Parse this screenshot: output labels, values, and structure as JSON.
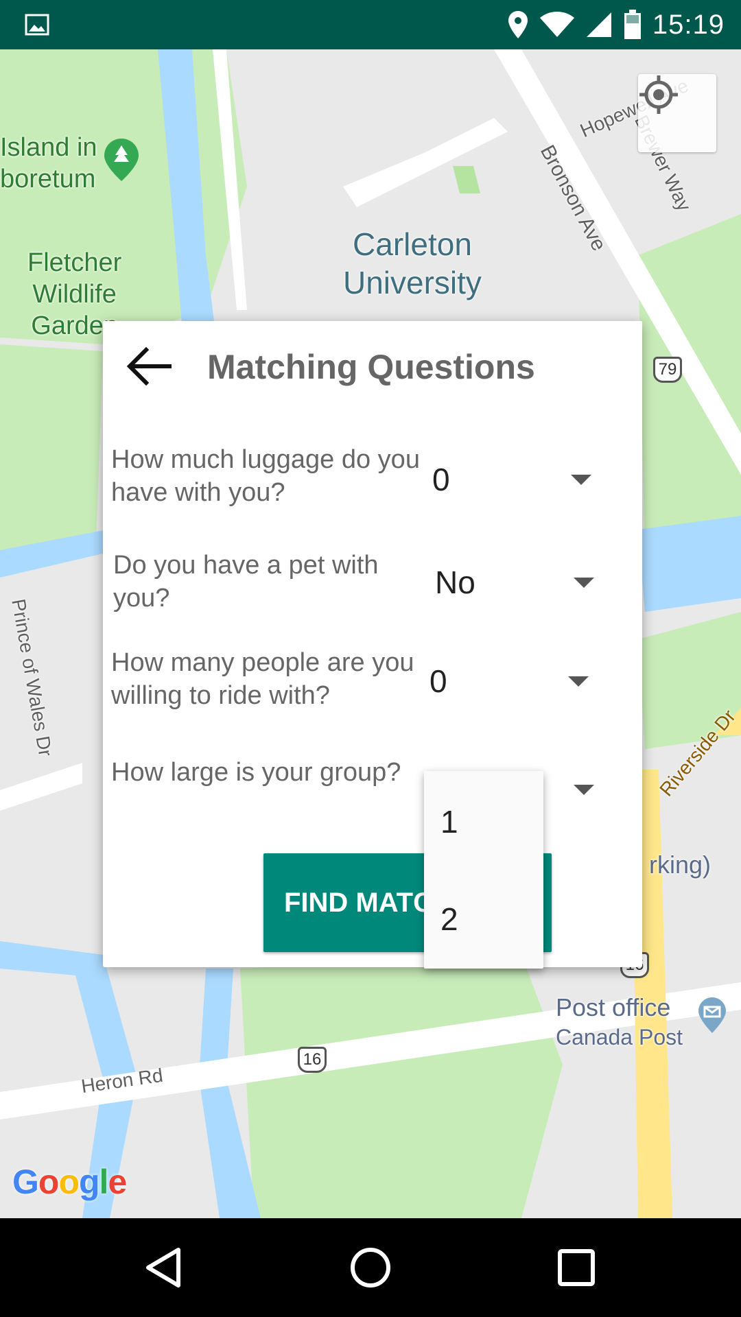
{
  "status_bar": {
    "time": "15:19",
    "icons": [
      "image-icon",
      "location-icon",
      "wifi-icon",
      "signal-icon",
      "battery-icon"
    ]
  },
  "map": {
    "park_labels": [
      "Island in",
      "boretum",
      "Fletcher",
      "Wildlife",
      "Garden"
    ],
    "campus_label": [
      "Carleton",
      "University"
    ],
    "road_labels": {
      "hopewell": "Hopewell Ave",
      "brewer": "Brewer Way",
      "bronson": "Bronson Ave",
      "riverside": "Riverside Dr",
      "prince_of_wales": "Prince of Wales Dr",
      "heron": "Heron Rd"
    },
    "route_shields": [
      "79",
      "16",
      "16"
    ],
    "poi": {
      "title": "Post office",
      "subtitle": "Canada Post",
      "parking_fragment": "rking)"
    },
    "logo": [
      "G",
      "o",
      "o",
      "g",
      "l",
      "e"
    ],
    "colors": {
      "park": "#c8ecb8",
      "water": "#aadaff",
      "road": "#ffffff",
      "highway": "#ffe68a",
      "land": "#e9e9e9"
    }
  },
  "dialog": {
    "title": "Matching Questions",
    "questions": [
      {
        "text": "How much luggage do you have with you?",
        "value": "0"
      },
      {
        "text": "Do you have a pet with you?",
        "value": "No"
      },
      {
        "text": "How many people are you willing to ride with?",
        "value": "0"
      },
      {
        "text": "How large is your group?",
        "value": ""
      }
    ],
    "find_button_label": "FIND MATCHES",
    "dropdown_options": [
      "1",
      "2"
    ],
    "accent_color": "#00897b"
  },
  "nav_bar": {
    "buttons": [
      "back-icon",
      "home-icon",
      "recents-icon"
    ]
  }
}
